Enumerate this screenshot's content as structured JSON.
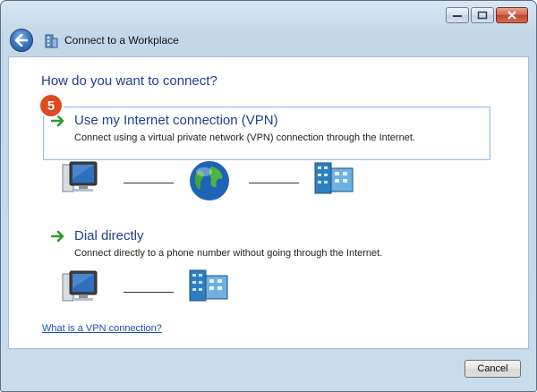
{
  "window": {
    "title": "Connect to a Workplace"
  },
  "page": {
    "heading": "How do you want to connect?",
    "step_badge": "5"
  },
  "options": [
    {
      "title": "Use my Internet connection (VPN)",
      "description": "Connect using a virtual private network (VPN) connection through the Internet."
    },
    {
      "title": "Dial directly",
      "description": "Connect directly to a phone number without going through the Internet."
    }
  ],
  "help_link": "What is a VPN connection?",
  "buttons": {
    "cancel": "Cancel"
  },
  "colors": {
    "accent_text": "#1f3f8f",
    "badge": "#e0491f",
    "link": "#1c4fb0"
  },
  "icons": [
    "back-arrow-icon",
    "workplace-icon",
    "computer-icon",
    "globe-icon",
    "server-icon",
    "green-arrow-icon"
  ]
}
